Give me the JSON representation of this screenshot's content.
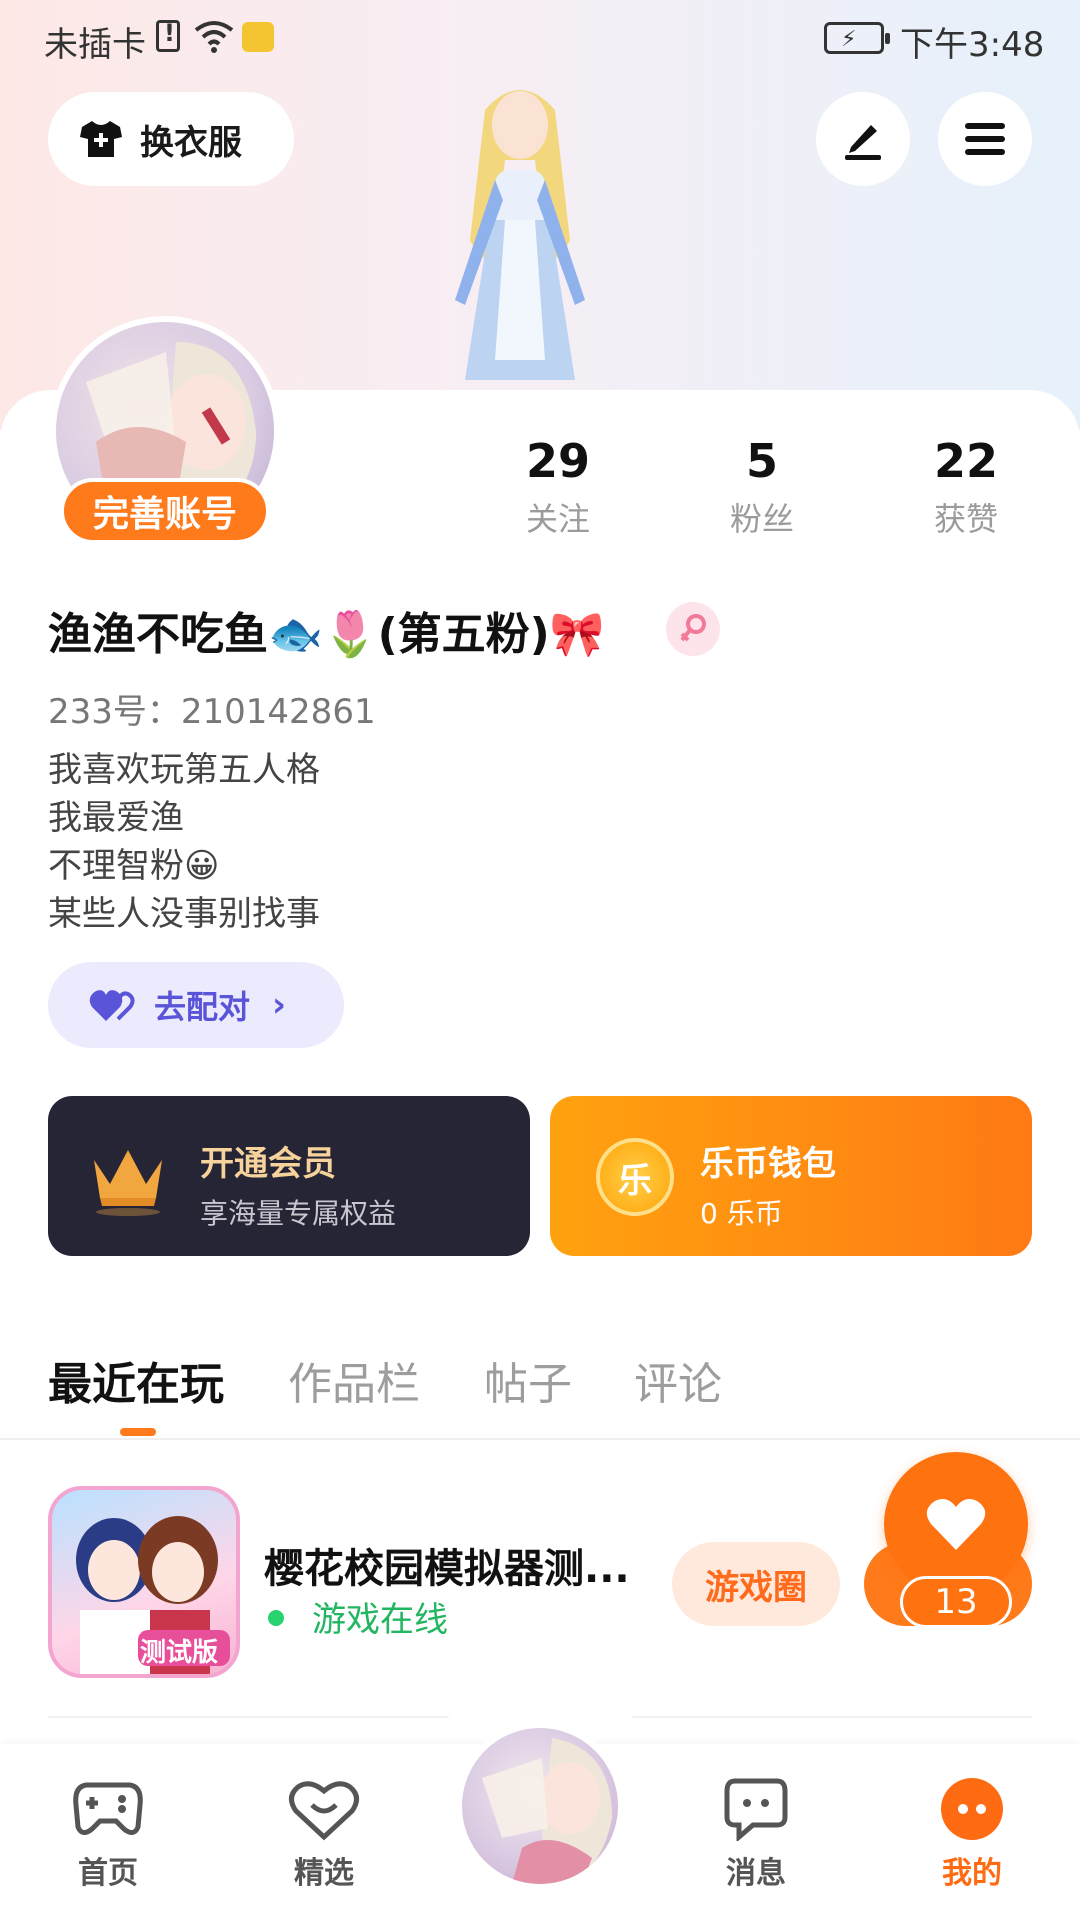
{
  "status_bar": {
    "carrier": "未插卡",
    "time": "下午3:48"
  },
  "header": {
    "change_clothes_label": "换衣服"
  },
  "profile": {
    "complete_account_label": "完善账号",
    "stats": [
      {
        "value": "29",
        "label": "关注"
      },
      {
        "value": "5",
        "label": "粉丝"
      },
      {
        "value": "22",
        "label": "获赞"
      }
    ],
    "nickname": "渔渔不吃鱼🐟🌷(第五粉)🎀",
    "uid": "233号：210142861",
    "bio": [
      "我喜欢玩第五人格",
      "我最爱渔",
      "不理智粉😀",
      "某些人没事别找事"
    ],
    "pair_button_label": "去配对"
  },
  "cards": {
    "vip": {
      "title": "开通会员",
      "subtitle": "享海量专属权益"
    },
    "wallet": {
      "icon_char": "乐",
      "title": "乐币钱包",
      "subtitle": "0 乐币"
    }
  },
  "tabs": [
    {
      "label": "最近在玩",
      "active": true
    },
    {
      "label": "作品栏",
      "active": false
    },
    {
      "label": "帖子",
      "active": false
    },
    {
      "label": "评论",
      "active": false
    }
  ],
  "recent_game": {
    "name": "樱花校园模拟器测...",
    "status": "游戏在线",
    "circle_label": "游戏圈",
    "icon_badge": "测试版"
  },
  "like": {
    "count": "13"
  },
  "bottom_nav": [
    {
      "label": "首页",
      "icon": "gamepad-icon"
    },
    {
      "label": "精选",
      "icon": "heart-chat-icon"
    },
    {
      "label": "",
      "icon": "avatar"
    },
    {
      "label": "消息",
      "icon": "message-icon"
    },
    {
      "label": "我的",
      "icon": "profile-icon",
      "active": true
    }
  ],
  "colors": {
    "accent": "#ff7a1a",
    "online": "#22b660",
    "vip_bg": "#262536",
    "pair_text": "#5a55d8"
  }
}
